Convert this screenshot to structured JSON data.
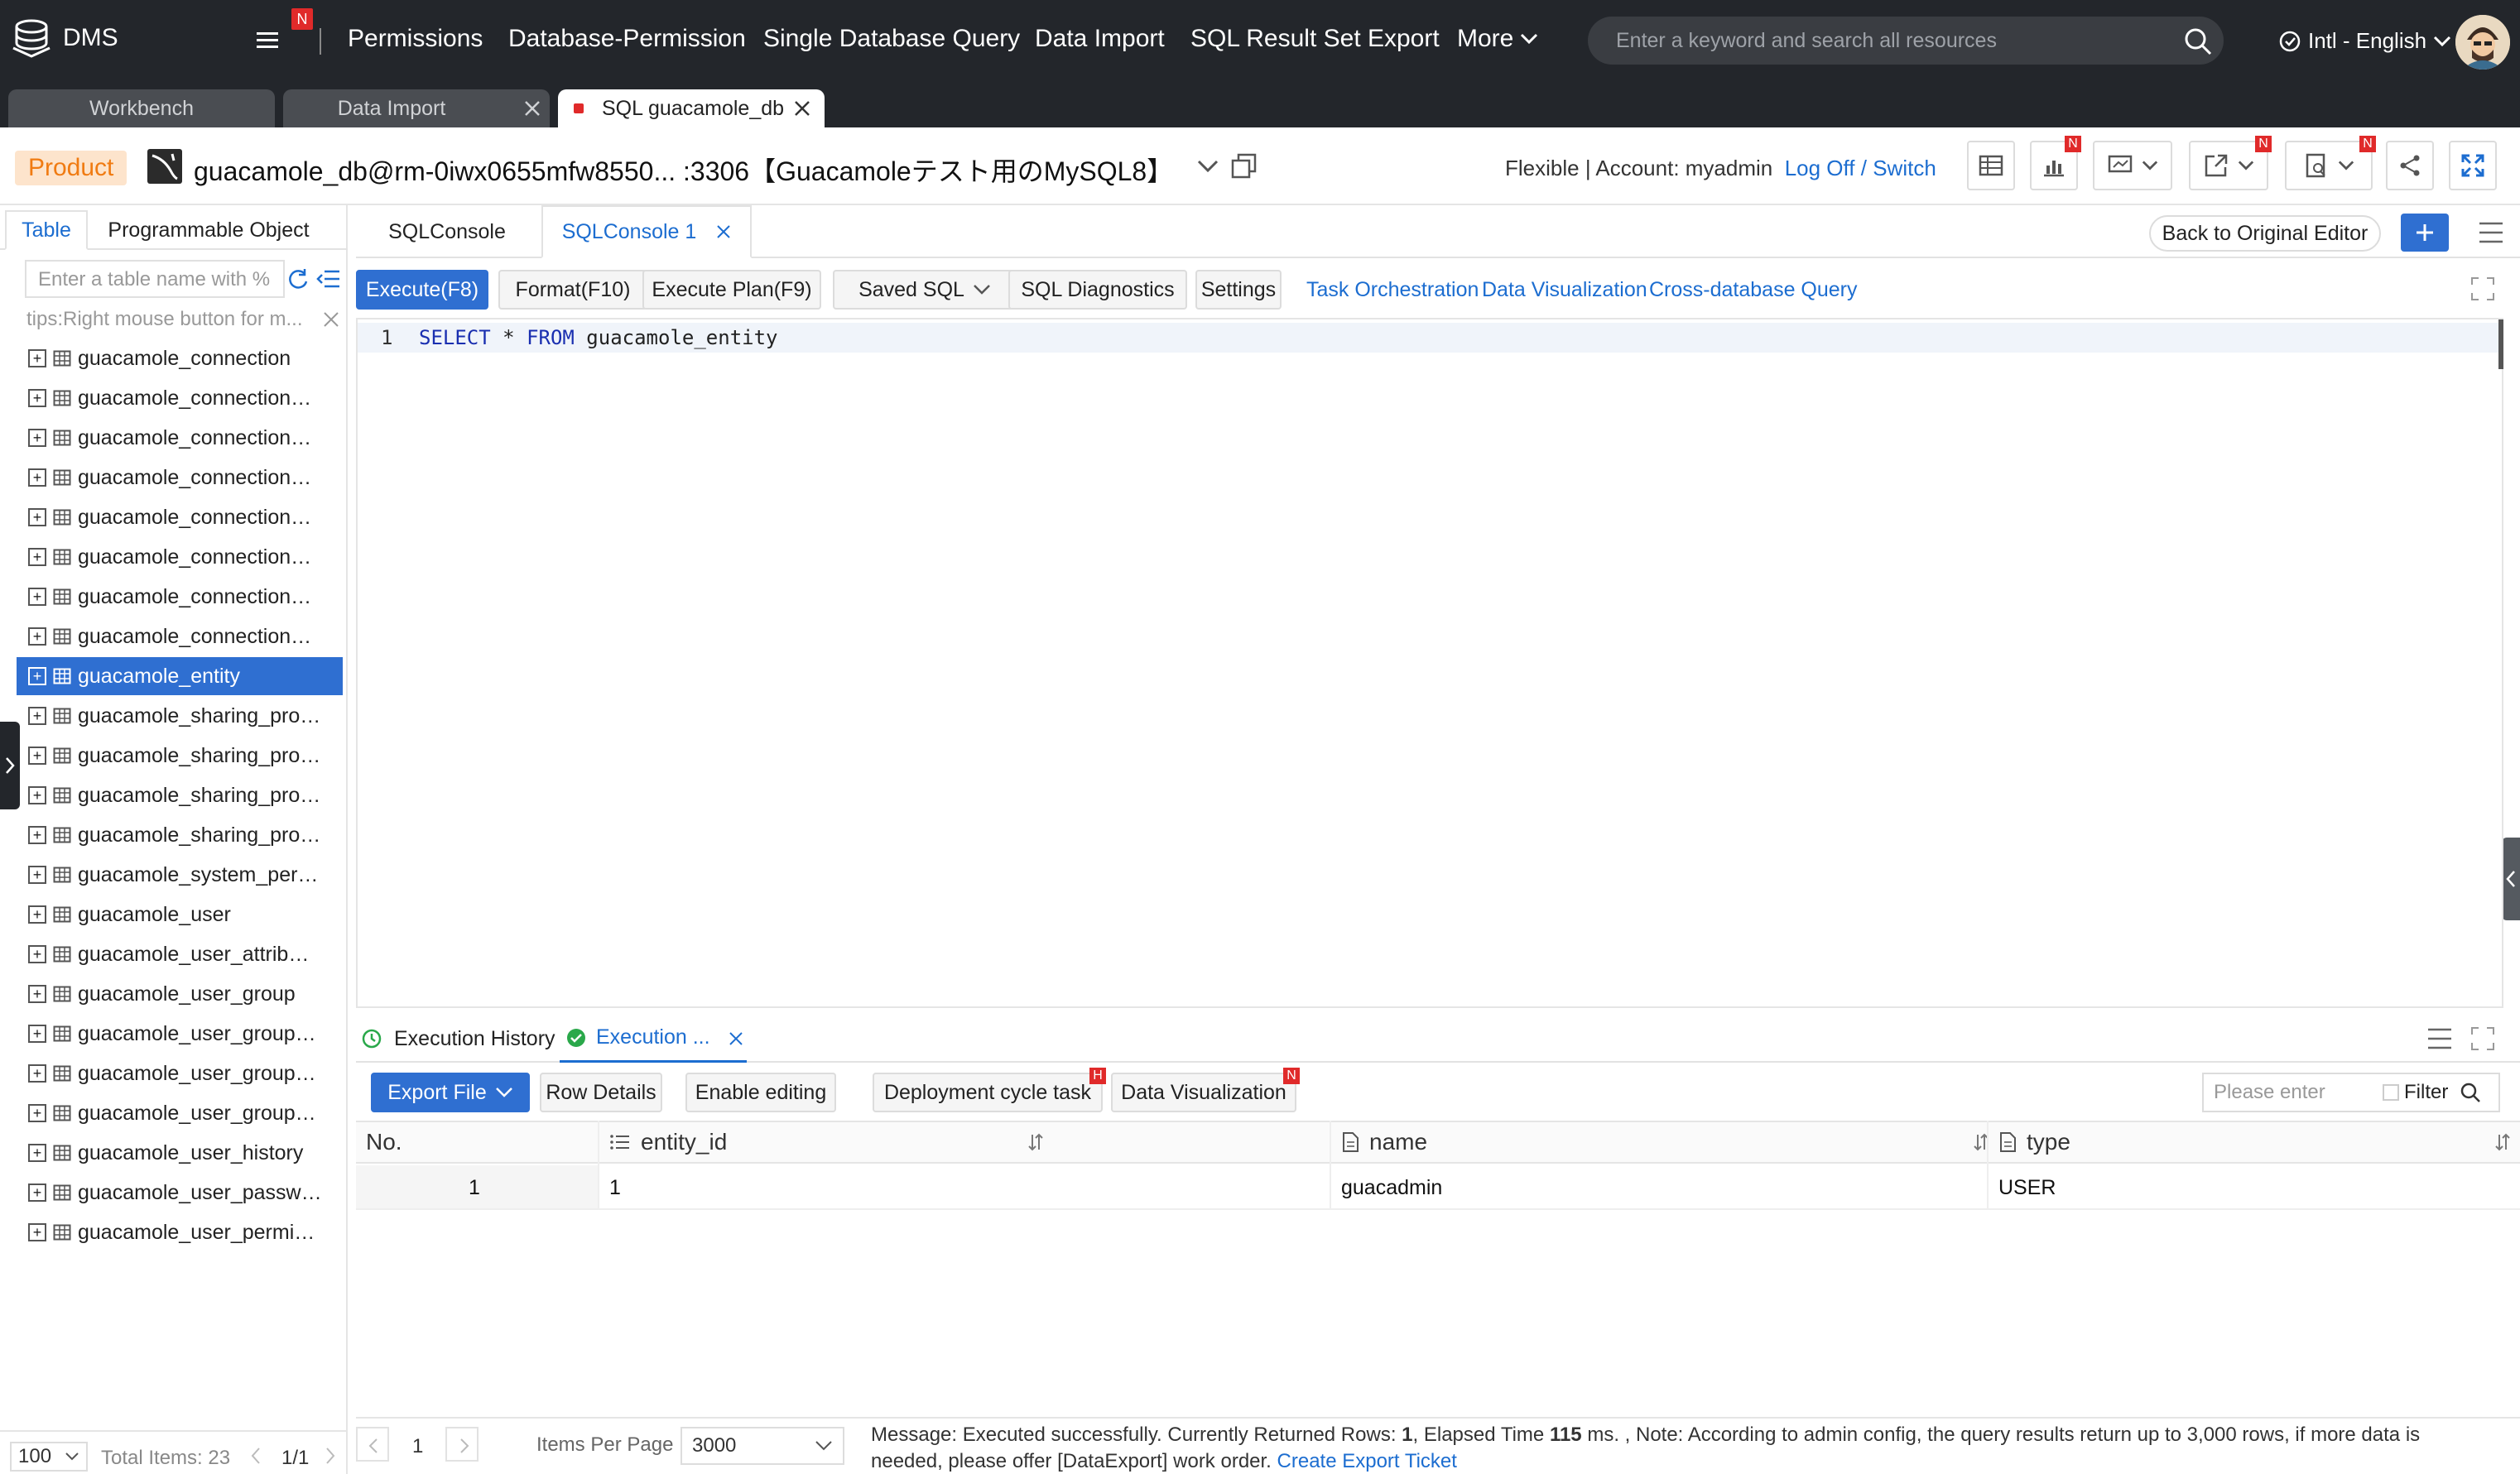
{
  "topnav": {
    "app_name": "DMS",
    "badge": "N",
    "items": [
      "Permissions",
      "Database-Permission",
      "Single Database Query",
      "Data Import",
      "SQL Result Set Export",
      "More"
    ],
    "search_placeholder": "Enter a keyword and search all resources",
    "language": "Intl - English"
  },
  "window_tabs": [
    {
      "label": "Workbench"
    },
    {
      "label": "Data Import"
    },
    {
      "label": "SQL guacamole_db"
    }
  ],
  "connection": {
    "product_badge": "Product",
    "title": "guacamole_db@rm-0iwx0655mfw8550... :3306【Guacamoleテスト用のMySQL8】",
    "mode": "Flexible",
    "account_label": "Account: myadmin",
    "logoff": "Log Off",
    "switch": "Switch",
    "badge": "N"
  },
  "sidebar": {
    "tabs": [
      "Table",
      "Programmable Object"
    ],
    "filter_placeholder": "Enter a table name with %",
    "tips": "tips:Right mouse button for m...",
    "tables": [
      "guacamole_connection",
      "guacamole_connection…",
      "guacamole_connection…",
      "guacamole_connection…",
      "guacamole_connection…",
      "guacamole_connection…",
      "guacamole_connection…",
      "guacamole_connection…",
      "guacamole_entity",
      "guacamole_sharing_pro…",
      "guacamole_sharing_pro…",
      "guacamole_sharing_pro…",
      "guacamole_sharing_pro…",
      "guacamole_system_per…",
      "guacamole_user",
      "guacamole_user_attrib…",
      "guacamole_user_group",
      "guacamole_user_group…",
      "guacamole_user_group…",
      "guacamole_user_group…",
      "guacamole_user_history",
      "guacamole_user_passw…",
      "guacamole_user_permi…"
    ],
    "selected_index": 8,
    "page_size": "100",
    "total": "Total Items: 23",
    "page": "1/1"
  },
  "console": {
    "tabs": [
      "SQLConsole",
      "SQLConsole 1"
    ],
    "back_button": "Back to Original Editor",
    "toolbar": {
      "execute": "Execute(F8)",
      "format": "Format(F10)",
      "plan": "Execute Plan(F9)",
      "saved": "Saved SQL",
      "diagnostics": "SQL Diagnostics",
      "settings": "Settings",
      "links": [
        "Task Orchestration",
        "Data Visualization",
        "Cross-database Query"
      ]
    },
    "editor": {
      "line_no": "1",
      "kw1": "SELECT",
      "mid": " * ",
      "kw2": "FROM",
      "rest": " guacamole_entity"
    }
  },
  "results": {
    "tabs": [
      "Execution History",
      "Execution ..."
    ],
    "export": "Export File",
    "row_details": "Row Details",
    "enable_editing": "Enable editing",
    "deployment": "Deployment cycle task",
    "deployment_badge": "H",
    "data_viz": "Data Visualization",
    "data_viz_badge": "N",
    "filter_placeholder": "Please enter",
    "filter_label": "Filter",
    "columns": [
      "No.",
      "entity_id",
      "name",
      "type"
    ],
    "rows": [
      [
        "1",
        "1",
        "guacadmin",
        "USER"
      ]
    ],
    "page": "1",
    "items_per_page_label": "Items Per Page",
    "items_per_page": "3000",
    "msg_prefix": "Message: Executed successfully. Currently Returned Rows: ",
    "msg_rows": "1",
    "msg_mid": ", Elapsed Time ",
    "msg_time": "115",
    "msg_suffix": " ms. ,  Note: According to admin config, the query results return up to 3,000 rows, if more data is",
    "msg_line2": "needed, please offer [DataExport] work order. ",
    "msg_link": "Create Export Ticket"
  }
}
